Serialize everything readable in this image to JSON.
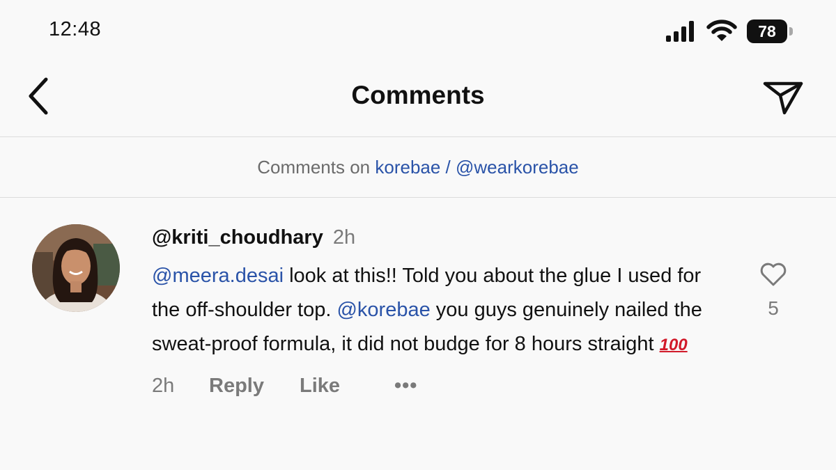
{
  "status_bar": {
    "time": "12:48",
    "battery": "78"
  },
  "header": {
    "title": "Comments"
  },
  "subheader": {
    "prefix": "Comments on",
    "link": "korebae / @wearkorebae"
  },
  "comment": {
    "username": "@kriti_choudhary",
    "time": "2h",
    "mention1": "@meera.desai",
    "text1": " look at this!! Told you about the glue I used for the off-shoulder top. ",
    "mention2": "@korebae",
    "text2": " you guys genuinely nailed the sweat-proof formula, it did not budge for 8 hours straight ",
    "emoji": "100",
    "actions": {
      "time": "2h",
      "reply": "Reply",
      "like": "Like",
      "more": "•••"
    },
    "like_count": "5"
  },
  "colors": {
    "link": "#2a53a8",
    "muted": "#7a7a7a",
    "background": "#f9f9f9"
  },
  "icons": [
    "chevron-left-icon",
    "send-icon",
    "heart-icon",
    "signal-icon",
    "wifi-icon",
    "battery-icon"
  ]
}
